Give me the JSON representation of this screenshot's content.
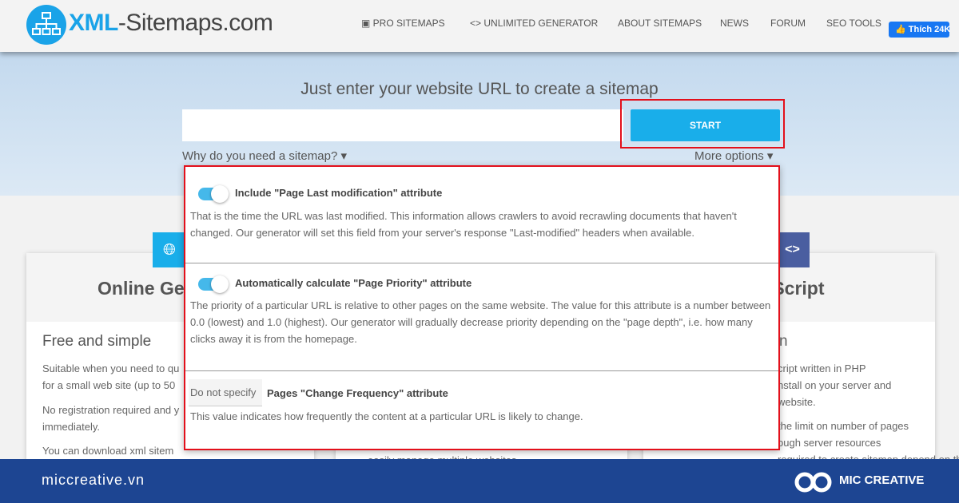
{
  "header": {
    "logo_bold": "XML",
    "logo_rest": "-Sitemaps.com",
    "nav": [
      "PRO SITEMAPS",
      "UNLIMITED GENERATOR",
      "ABOUT SITEMAPS",
      "NEWS",
      "FORUM",
      "SEO TOOLS"
    ],
    "like_label": "Thích 24K"
  },
  "hero": {
    "title": "Just enter your website URL to create a sitemap",
    "url_value": "",
    "start_label": "START",
    "why_label": "Why do you need a sitemap? ▾",
    "more_label": "More options ▾"
  },
  "options": [
    {
      "title": "Include \"Page Last modification\" attribute",
      "enabled": true,
      "desc": "That is the time the URL was last modified. This information allows crawlers to avoid recrawling documents that haven't changed. Our generator will set this field from your server's response \"Last-modified\" headers when available."
    },
    {
      "title": "Automatically calculate \"Page Priority\" attribute",
      "enabled": true,
      "desc": "The priority of a particular URL is relative to other pages on the same website. The value for this attribute is a number between 0.0 (lowest) and 1.0 (highest). Our generator will gradually decrease priority depending on the \"page depth\", i.e. how many clicks away it is from the homepage."
    },
    {
      "title": "Pages \"Change Frequency\" attribute",
      "select_value": "Do not specify",
      "desc": "This value indicates how frequently the content at a particular URL is likely to change."
    }
  ],
  "cards": {
    "left": {
      "title": "Online Ge",
      "subtitle": "Free and simple",
      "p1": "Suitable when you need to qu\nfor a small web site (up to 50",
      "p2": "No registration required and y\nimmediately.",
      "p3": "You can download xml sitem"
    },
    "right": {
      "title": "P Script",
      "subtitle": "n",
      "p1": "cript written in PHP\nnstall on your server and\nwebsite.",
      "p2": "the limit on number of pages\nough server resources\nrequired to create sitemap depend on the website"
    },
    "middle": {
      "p1": "easily manage multiple websites"
    }
  },
  "footer": {
    "site": "miccreative.vn",
    "brand": "MIC CREATIVE"
  },
  "colors": {
    "accent": "#19aeea",
    "highlight": "#e3101b",
    "footer": "#1d4592",
    "code_icon_bg": "#4a5ea0"
  }
}
